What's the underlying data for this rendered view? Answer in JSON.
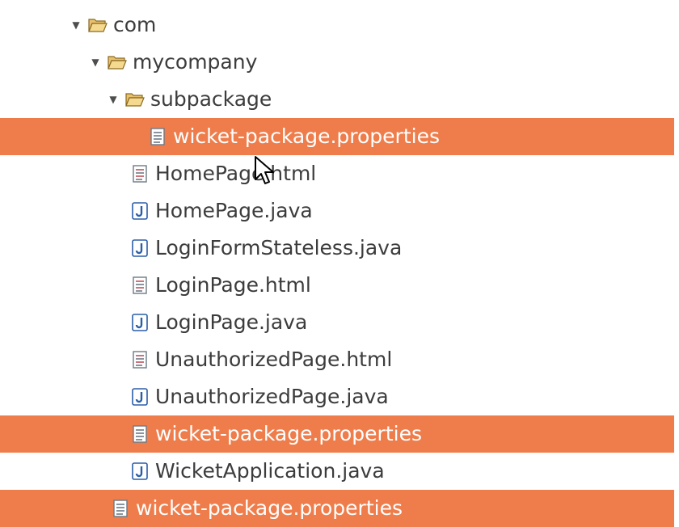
{
  "tree": {
    "items": [
      {
        "label": "com",
        "type": "folder"
      },
      {
        "label": "mycompany",
        "type": "folder"
      },
      {
        "label": "subpackage",
        "type": "folder"
      },
      {
        "label": "wicket-package.properties",
        "type": "properties",
        "selected": true
      },
      {
        "label": "HomePage.html",
        "type": "html"
      },
      {
        "label": "HomePage.java",
        "type": "java"
      },
      {
        "label": "LoginFormStateless.java",
        "type": "java"
      },
      {
        "label": "LoginPage.html",
        "type": "html"
      },
      {
        "label": "LoginPage.java",
        "type": "java"
      },
      {
        "label": "UnauthorizedPage.html",
        "type": "html"
      },
      {
        "label": "UnauthorizedPage.java",
        "type": "java"
      },
      {
        "label": "wicket-package.properties",
        "type": "properties",
        "selected": true
      },
      {
        "label": "WicketApplication.java",
        "type": "java"
      },
      {
        "label": "wicket-package.properties",
        "type": "properties",
        "selected": true
      }
    ]
  },
  "colors": {
    "selection": "#ee7d4b",
    "folder": "#d8a64a",
    "java_icon": "#2b5ea7"
  }
}
